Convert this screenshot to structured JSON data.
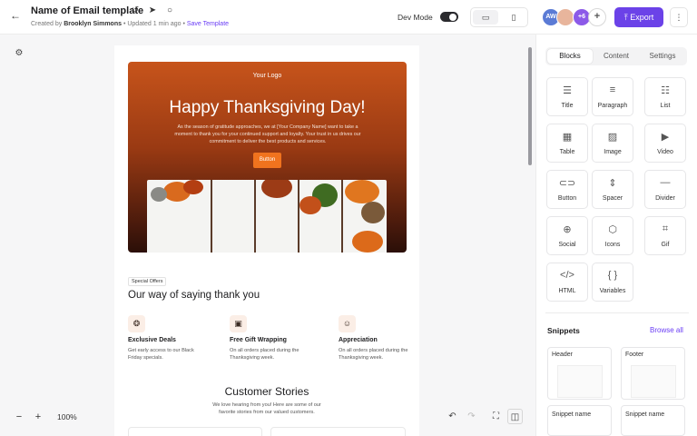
{
  "header": {
    "title": "Name of Email template",
    "created_by_prefix": "Created by",
    "author": "Brooklyn Simmons",
    "updated": "• Updated 1 min ago •",
    "save_template": "Save Template",
    "dev_mode_label": "Dev Mode",
    "dev_mode_on": false,
    "avatar_initials": "AW",
    "avatar_more": "+6",
    "export_label": "Export"
  },
  "email": {
    "hero": {
      "logo": "Your Logo",
      "title": "Happy Thanksgiving Day!",
      "text": "As the season of gratitude approaches, we at [Your Company Name] want to take a moment to thank you for your continued support and loyalty. Your trust in us drives our commitment to deliver the best products and services.",
      "button": "Button"
    },
    "offer_tag": "Special Offers",
    "section_title": "Our way of saying thank you",
    "features": [
      {
        "icon": "trophy-icon",
        "title": "Exclusive Deals",
        "text": "Get early access to our Black Friday specials."
      },
      {
        "icon": "gift-icon",
        "title": "Free Gift Wrapping",
        "text": "On all orders placed during the Thanksgiving week."
      },
      {
        "icon": "person-icon",
        "title": "Appreciation",
        "text": "On all orders placed during the Thanksgiving week."
      }
    ],
    "stories_title": "Customer Stories",
    "stories_sub": "We love hearing from you! Here are some of our favorite stories from our valued customers."
  },
  "canvas_toolbar": {
    "zoom": "100%"
  },
  "panel": {
    "tabs": [
      "Blocks",
      "Content",
      "Settings"
    ],
    "active_tab": "Blocks",
    "blocks": [
      {
        "label": "Title",
        "icon": "title-icon",
        "glyph": "☰"
      },
      {
        "label": "Paragraph",
        "icon": "paragraph-icon",
        "glyph": "≡"
      },
      {
        "label": "List",
        "icon": "list-icon",
        "glyph": "☷"
      },
      {
        "label": "Table",
        "icon": "table-icon",
        "glyph": "▦"
      },
      {
        "label": "Image",
        "icon": "image-icon",
        "glyph": "▨"
      },
      {
        "label": "Video",
        "icon": "video-icon",
        "glyph": "▶"
      },
      {
        "label": "Button",
        "icon": "button-icon",
        "glyph": "⊂⊃"
      },
      {
        "label": "Spacer",
        "icon": "spacer-icon",
        "glyph": "⇕"
      },
      {
        "label": "Divider",
        "icon": "divider-icon",
        "glyph": "—"
      },
      {
        "label": "Social",
        "icon": "social-icon",
        "glyph": "⊕"
      },
      {
        "label": "Icons",
        "icon": "icons-icon",
        "glyph": "⬡"
      },
      {
        "label": "Gif",
        "icon": "gif-icon",
        "glyph": "⌗"
      },
      {
        "label": "HTML",
        "icon": "html-icon",
        "glyph": "</>"
      },
      {
        "label": "Variables",
        "icon": "variables-icon",
        "glyph": "{ }"
      }
    ],
    "snippets_title": "Snippets",
    "browse_all": "Browse all",
    "snippets": [
      "Header",
      "Footer",
      "Snippet name",
      "Snippet name"
    ]
  },
  "colors": {
    "accent": "#6b42e8",
    "hero_button": "#f0731e"
  }
}
